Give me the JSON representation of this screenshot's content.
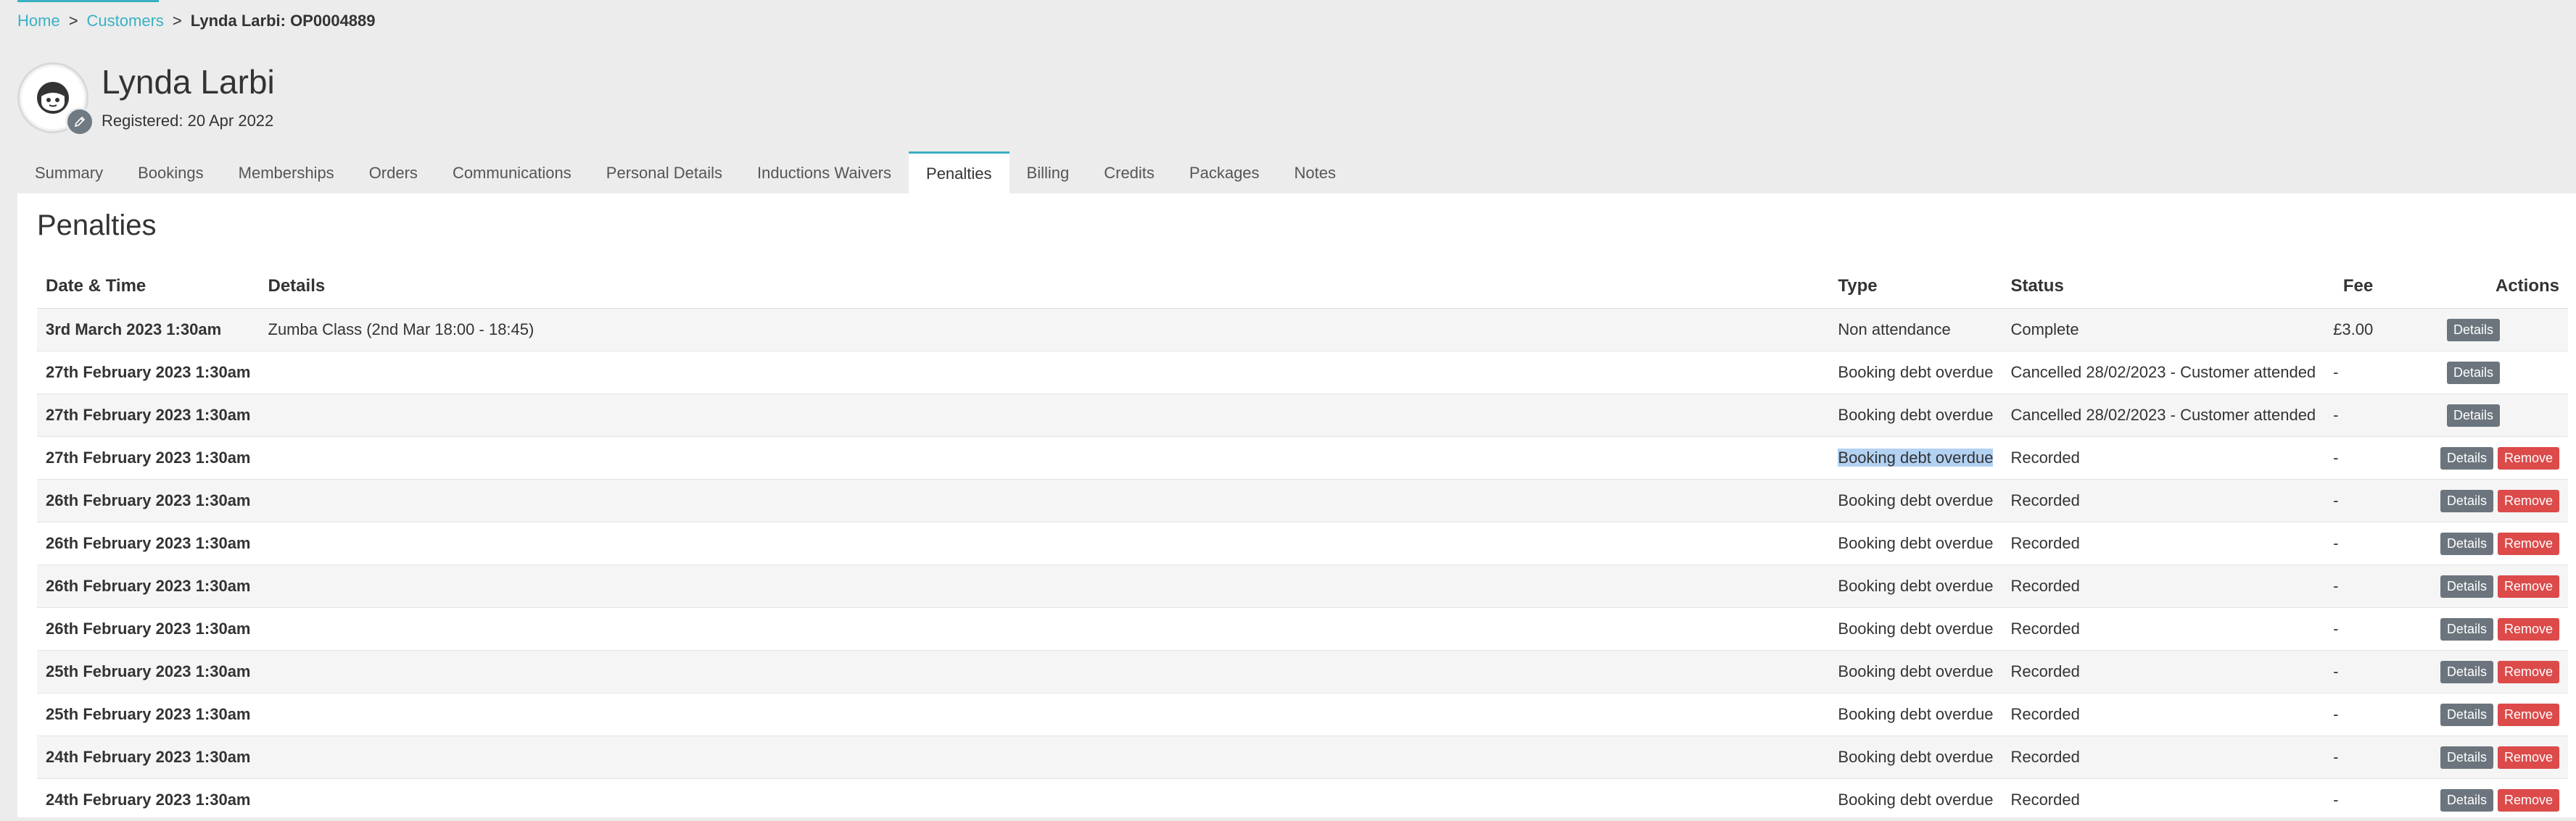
{
  "breadcrumb": {
    "home": "Home",
    "customers": "Customers",
    "sep": ">",
    "current": "Lynda Larbi: OP0004889"
  },
  "customer": {
    "name": "Lynda Larbi",
    "registered": "Registered: 20 Apr 2022"
  },
  "tabs": [
    {
      "label": "Summary"
    },
    {
      "label": "Bookings"
    },
    {
      "label": "Memberships"
    },
    {
      "label": "Orders"
    },
    {
      "label": "Communications"
    },
    {
      "label": "Personal Details"
    },
    {
      "label": "Inductions Waivers"
    },
    {
      "label": "Penalties",
      "active": true
    },
    {
      "label": "Billing"
    },
    {
      "label": "Credits"
    },
    {
      "label": "Packages"
    },
    {
      "label": "Notes"
    }
  ],
  "penalties": {
    "title": "Penalties",
    "columns": {
      "date": "Date & Time",
      "details": "Details",
      "type": "Type",
      "status": "Status",
      "fee": "Fee",
      "actions": "Actions"
    },
    "details_label": "Details",
    "remove_label": "Remove",
    "rows": [
      {
        "date": "3rd March 2023 1:30am",
        "details": "Zumba Class (2nd Mar 18:00 - 18:45)",
        "type": "Non attendance",
        "status": "Complete",
        "fee": "£3.00",
        "removable": false
      },
      {
        "date": "27th February 2023 1:30am",
        "details": "",
        "type": "Booking debt overdue",
        "status": "Cancelled 28/02/2023 - Customer attended",
        "fee": "-",
        "removable": false
      },
      {
        "date": "27th February 2023 1:30am",
        "details": "",
        "type": "Booking debt overdue",
        "status": "Cancelled 28/02/2023 - Customer attended",
        "fee": "-",
        "removable": false
      },
      {
        "date": "27th February 2023 1:30am",
        "details": "",
        "type": "Booking debt overdue",
        "status": "Recorded",
        "fee": "-",
        "removable": true,
        "selected": true
      },
      {
        "date": "26th February 2023 1:30am",
        "details": "",
        "type": "Booking debt overdue",
        "status": "Recorded",
        "fee": "-",
        "removable": true
      },
      {
        "date": "26th February 2023 1:30am",
        "details": "",
        "type": "Booking debt overdue",
        "status": "Recorded",
        "fee": "-",
        "removable": true
      },
      {
        "date": "26th February 2023 1:30am",
        "details": "",
        "type": "Booking debt overdue",
        "status": "Recorded",
        "fee": "-",
        "removable": true
      },
      {
        "date": "26th February 2023 1:30am",
        "details": "",
        "type": "Booking debt overdue",
        "status": "Recorded",
        "fee": "-",
        "removable": true
      },
      {
        "date": "25th February 2023 1:30am",
        "details": "",
        "type": "Booking debt overdue",
        "status": "Recorded",
        "fee": "-",
        "removable": true
      },
      {
        "date": "25th February 2023 1:30am",
        "details": "",
        "type": "Booking debt overdue",
        "status": "Recorded",
        "fee": "-",
        "removable": true
      },
      {
        "date": "24th February 2023 1:30am",
        "details": "",
        "type": "Booking debt overdue",
        "status": "Recorded",
        "fee": "-",
        "removable": true
      },
      {
        "date": "24th February 2023 1:30am",
        "details": "",
        "type": "Booking debt overdue",
        "status": "Recorded",
        "fee": "-",
        "removable": true
      }
    ]
  },
  "colors": {
    "accent": "#3ab0c3",
    "details_button": "#6c757d",
    "remove_button": "#dc4a4a",
    "selection": "#b3d2f3"
  },
  "icons": {
    "avatar": "user-face-icon",
    "edit": "pencil-icon"
  }
}
